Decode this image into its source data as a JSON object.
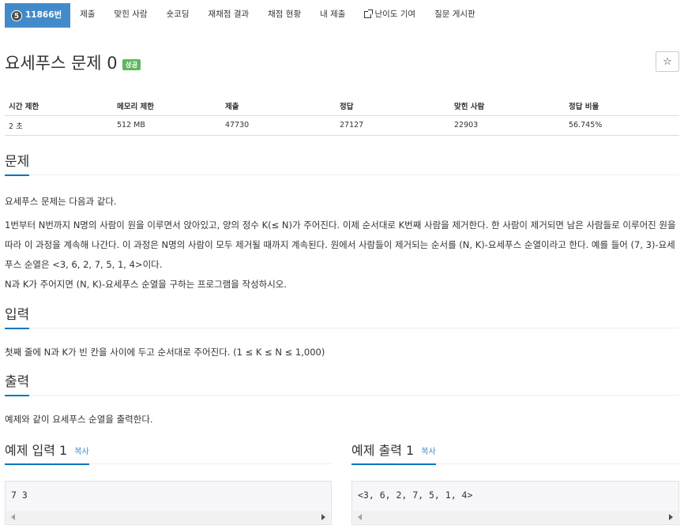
{
  "nav": {
    "problem_id": "11866번",
    "tier_badge": "5",
    "items": [
      "제출",
      "맞힌 사람",
      "숏코딩",
      "재채점 결과",
      "채점 현황",
      "내 제출",
      "난이도 기여",
      "질문 게시판"
    ]
  },
  "problem": {
    "title": "요세푸스 문제 0",
    "status_badge": "성공",
    "star": "☆"
  },
  "stats": {
    "headers": [
      "시간 제한",
      "메모리 제한",
      "제출",
      "정답",
      "맞힌 사람",
      "정답 비율"
    ],
    "values": [
      "2 초",
      "512 MB",
      "47730",
      "27127",
      "22903",
      "56.745%"
    ]
  },
  "sections": {
    "problem_heading": "문제",
    "problem_p1": "요세푸스 문제는 다음과 같다.",
    "problem_p2": "1번부터 N번까지 N명의 사람이 원을 이루면서 앉아있고, 양의 정수 K(≤ N)가 주어진다. 이제 순서대로 K번째 사람을 제거한다. 한 사람이 제거되면 남은 사람들로 이루어진 원을 따라 이 과정을 계속해 나간다. 이 과정은 N명의 사람이 모두 제거될 때까지 계속된다. 원에서 사람들이 제거되는 순서를 (N, K)-요세푸스 순열이라고 한다. 예를 들어 (7, 3)-요세푸스 순열은 <3, 6, 2, 7, 5, 1, 4>이다.",
    "problem_p3": "N과 K가 주어지면 (N, K)-요세푸스 순열을 구하는 프로그램을 작성하시오.",
    "input_heading": "입력",
    "input_p": "첫째 줄에 N과 K가 빈 칸을 사이에 두고 순서대로 주어진다. (1 ≤ K ≤ N ≤ 1,000)",
    "output_heading": "출력",
    "output_p": "예제와 같이 요세푸스 순열을 출력한다."
  },
  "samples": {
    "input_heading": "예제 입력 1",
    "output_heading": "예제 출력 1",
    "copy_label": "복사",
    "input_value": "7 3",
    "output_value": "<3, 6, 2, 7, 5, 1, 4>"
  },
  "colors": {
    "active_nav": "#428bca",
    "success_badge": "#5cb85c",
    "heading_underline": "#0076c0"
  }
}
